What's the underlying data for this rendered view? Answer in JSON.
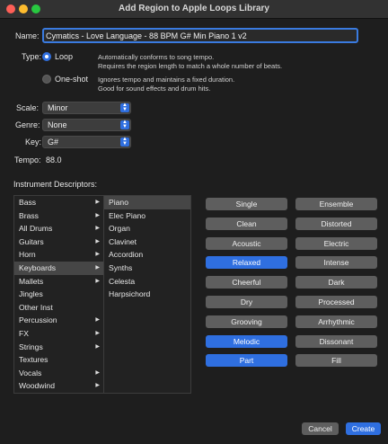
{
  "window": {
    "title": "Add Region to Apple Loops Library"
  },
  "name": {
    "label": "Name:",
    "value": "Cymatics - Love Language - 88 BPM G# Min Piano 1 v2"
  },
  "type": {
    "label": "Type:",
    "loop": {
      "label": "Loop",
      "selected": true,
      "desc1": "Automatically conforms to song tempo.",
      "desc2": "Requires the region length to match a whole number of beats."
    },
    "oneshot": {
      "label": "One-shot",
      "selected": false,
      "desc1": "Ignores tempo and maintains a fixed duration.",
      "desc2": "Good for sound effects and drum hits."
    }
  },
  "scale": {
    "label": "Scale:",
    "value": "Minor"
  },
  "genre": {
    "label": "Genre:",
    "value": "None"
  },
  "key": {
    "label": "Key:",
    "value": "G#"
  },
  "tempo": {
    "label": "Tempo:",
    "value": "88.0"
  },
  "instrument": {
    "heading": "Instrument Descriptors:",
    "categories": [
      {
        "label": "Bass",
        "arrow": true
      },
      {
        "label": "Brass",
        "arrow": true
      },
      {
        "label": "All Drums",
        "arrow": true
      },
      {
        "label": "Guitars",
        "arrow": true
      },
      {
        "label": "Horn",
        "arrow": true
      },
      {
        "label": "Keyboards",
        "arrow": true,
        "selected": true
      },
      {
        "label": "Mallets",
        "arrow": true
      },
      {
        "label": "Jingles",
        "arrow": false
      },
      {
        "label": "Other Inst",
        "arrow": false
      },
      {
        "label": "Percussion",
        "arrow": true
      },
      {
        "label": "FX",
        "arrow": true
      },
      {
        "label": "Strings",
        "arrow": true
      },
      {
        "label": "Textures",
        "arrow": false
      },
      {
        "label": "Vocals",
        "arrow": true
      },
      {
        "label": "Woodwind",
        "arrow": true
      }
    ],
    "subitems": [
      {
        "label": "Piano",
        "selected": true
      },
      {
        "label": "Elec Piano"
      },
      {
        "label": "Organ"
      },
      {
        "label": "Clavinet"
      },
      {
        "label": "Accordion"
      },
      {
        "label": "Synths"
      },
      {
        "label": "Celesta"
      },
      {
        "label": "Harpsichord"
      }
    ]
  },
  "descriptors": [
    [
      {
        "label": "Single",
        "on": false
      },
      {
        "label": "Ensemble",
        "on": false
      }
    ],
    [
      {
        "label": "Clean",
        "on": false
      },
      {
        "label": "Distorted",
        "on": false
      }
    ],
    [
      {
        "label": "Acoustic",
        "on": false
      },
      {
        "label": "Electric",
        "on": false
      }
    ],
    [
      {
        "label": "Relaxed",
        "on": true
      },
      {
        "label": "Intense",
        "on": false
      }
    ],
    [
      {
        "label": "Cheerful",
        "on": false
      },
      {
        "label": "Dark",
        "on": false
      }
    ],
    [
      {
        "label": "Dry",
        "on": false
      },
      {
        "label": "Processed",
        "on": false
      }
    ],
    [
      {
        "label": "Grooving",
        "on": false
      },
      {
        "label": "Arrhythmic",
        "on": false
      }
    ],
    [
      {
        "label": "Melodic",
        "on": true
      },
      {
        "label": "Dissonant",
        "on": false
      }
    ],
    [
      {
        "label": "Part",
        "on": true
      },
      {
        "label": "Fill",
        "on": false
      }
    ]
  ],
  "buttons": {
    "cancel": "Cancel",
    "create": "Create"
  },
  "colors": {
    "accent": "#2f6fe0",
    "pill": "#5e5e5e",
    "background": "#1e1e1e"
  }
}
